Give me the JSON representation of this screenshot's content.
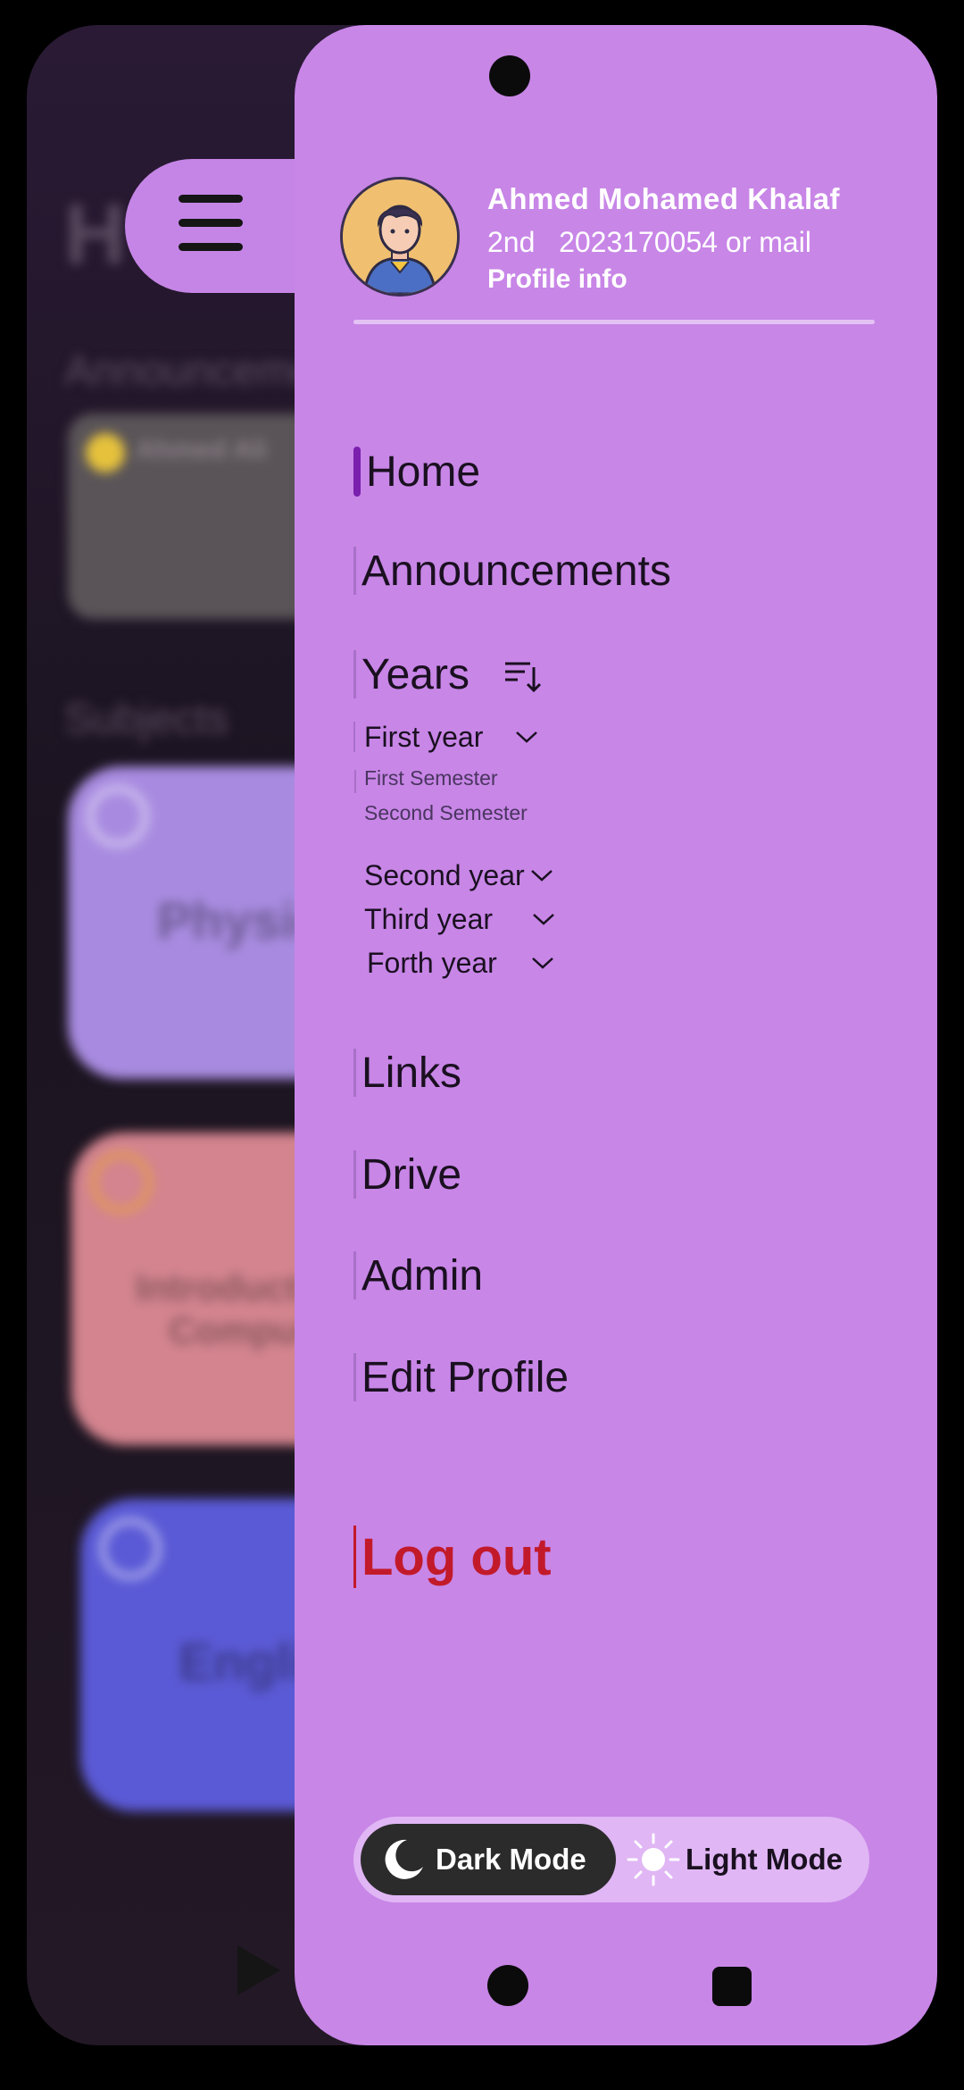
{
  "background": {
    "title_partial": "H",
    "section_announcements": "Announcements",
    "announcement_author": "Ahmed Ali",
    "section_subjects": "Subjects",
    "subjects": [
      {
        "label": "Physics",
        "color": "#a88be0",
        "progress": "0%"
      },
      {
        "label": "Introduction to Computing",
        "color": "#d3848e",
        "progress": "0%"
      },
      {
        "label": "English",
        "color": "#5b5ad6",
        "progress": "0%"
      }
    ]
  },
  "profile": {
    "name": "Ahmed Mohamed Khalaf",
    "id_line": "2nd   2023170054 or mail",
    "link": "Profile info"
  },
  "nav": {
    "home": "Home",
    "announcements": "Announcements",
    "years": "Years",
    "first_year": "First year",
    "first_semester": "First Semester",
    "second_semester": "Second Semester",
    "second_year": "Second year",
    "third_year": "Third year",
    "forth_year": "Forth year",
    "links": "Links",
    "drive": "Drive",
    "admin": "Admin",
    "edit_profile": "Edit Profile",
    "logout": "Log out"
  },
  "mode": {
    "dark": "Dark Mode",
    "light": "Light Mode"
  },
  "colors": {
    "drawer": "#c886e7",
    "active_indicator": "#7a1fae",
    "logout": "#c21a2a"
  }
}
